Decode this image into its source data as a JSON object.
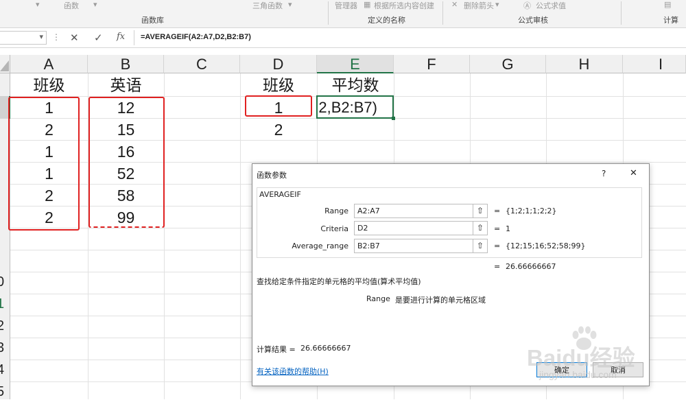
{
  "ribbon": {
    "items": [
      "函数",
      "三角函数",
      "管理器",
      "根据所选内容创建",
      "删除箭头",
      "公式求值"
    ],
    "groups": [
      "函数库",
      "定义的名称",
      "公式审核",
      "计算"
    ]
  },
  "formula_bar": {
    "fx_label": "fx",
    "formula": "=AVERAGEIF(A2:A7,D2,B2:B7)"
  },
  "columns": [
    "A",
    "B",
    "C",
    "D",
    "E",
    "F",
    "G",
    "H",
    "I"
  ],
  "row_numbers": [
    "0",
    "1",
    "2",
    "3",
    "4",
    "5"
  ],
  "sheet": {
    "a_header": "班级",
    "b_header": "英语",
    "a_values": [
      "1",
      "2",
      "1",
      "1",
      "2",
      "2"
    ],
    "b_values": [
      "12",
      "15",
      "16",
      "52",
      "58",
      "99"
    ],
    "d_header": "班级",
    "e_header": "平均数",
    "d_values": [
      "1",
      "2"
    ],
    "e2_edit": "2,B2:B7)"
  },
  "dialog": {
    "title": "函数参数",
    "help_q": "?",
    "close": "✕",
    "function_name": "AVERAGEIF",
    "args": [
      {
        "label": "Range",
        "value": "A2:A7",
        "result": "{1;2;1;1;2;2}"
      },
      {
        "label": "Criteria",
        "value": "D2",
        "result": "1"
      },
      {
        "label": "Average_range",
        "value": "B2:B7",
        "result": "{12;15;16;52;58;99}"
      }
    ],
    "equals": "=",
    "formula_result": "26.66666667",
    "description": "查找给定条件指定的单元格的平均值(算术平均值)",
    "arg_help_name": "Range",
    "arg_help_text": "是要进行计算的单元格区域",
    "calc_result_label": "计算结果 =",
    "calc_result_value": "26.66666667",
    "help_link": "有关该函数的帮助(H)",
    "ok": "确定",
    "cancel": "取消"
  },
  "watermark": {
    "brand": "Baidu经验",
    "url": "jingyan.baidu.com"
  }
}
